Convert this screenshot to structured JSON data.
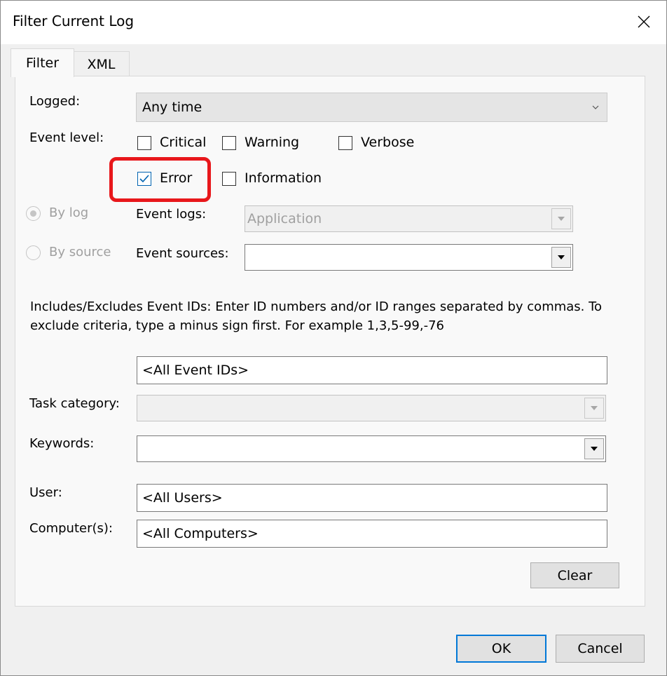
{
  "window": {
    "title": "Filter Current Log",
    "close_icon": "close-icon"
  },
  "tabs": [
    {
      "label": "Filter"
    },
    {
      "label": "XML"
    }
  ],
  "filter": {
    "logged": {
      "label": "Logged:",
      "value": "Any time"
    },
    "event_level": {
      "label": "Event level:",
      "critical": {
        "label": "Critical",
        "checked": false
      },
      "warning": {
        "label": "Warning",
        "checked": false
      },
      "verbose": {
        "label": "Verbose",
        "checked": false
      },
      "error": {
        "label": "Error",
        "checked": true
      },
      "information": {
        "label": "Information",
        "checked": false
      }
    },
    "by_log": {
      "label": "By log",
      "selected": true
    },
    "by_source": {
      "label": "By source",
      "selected": false
    },
    "event_logs": {
      "label": "Event logs:",
      "value": "Application"
    },
    "event_sources": {
      "label": "Event sources:",
      "value": ""
    },
    "description": "Includes/Excludes Event IDs: Enter ID numbers and/or ID ranges separated by commas. To exclude criteria, type a minus sign first. For example 1,3,5-99,-76",
    "event_ids": {
      "value": "<All Event IDs>"
    },
    "task_category": {
      "label": "Task category:",
      "value": ""
    },
    "keywords": {
      "label": "Keywords:",
      "value": ""
    },
    "user": {
      "label": "User:",
      "value": "<All Users>"
    },
    "computers": {
      "label": "Computer(s):",
      "value": "<All Computers>"
    },
    "clear_label": "Clear"
  },
  "footer": {
    "ok_label": "OK",
    "cancel_label": "Cancel"
  },
  "colors": {
    "accent": "#0078d7",
    "annotation": "#e8171b",
    "disabled_text": "#a0a0a0"
  }
}
